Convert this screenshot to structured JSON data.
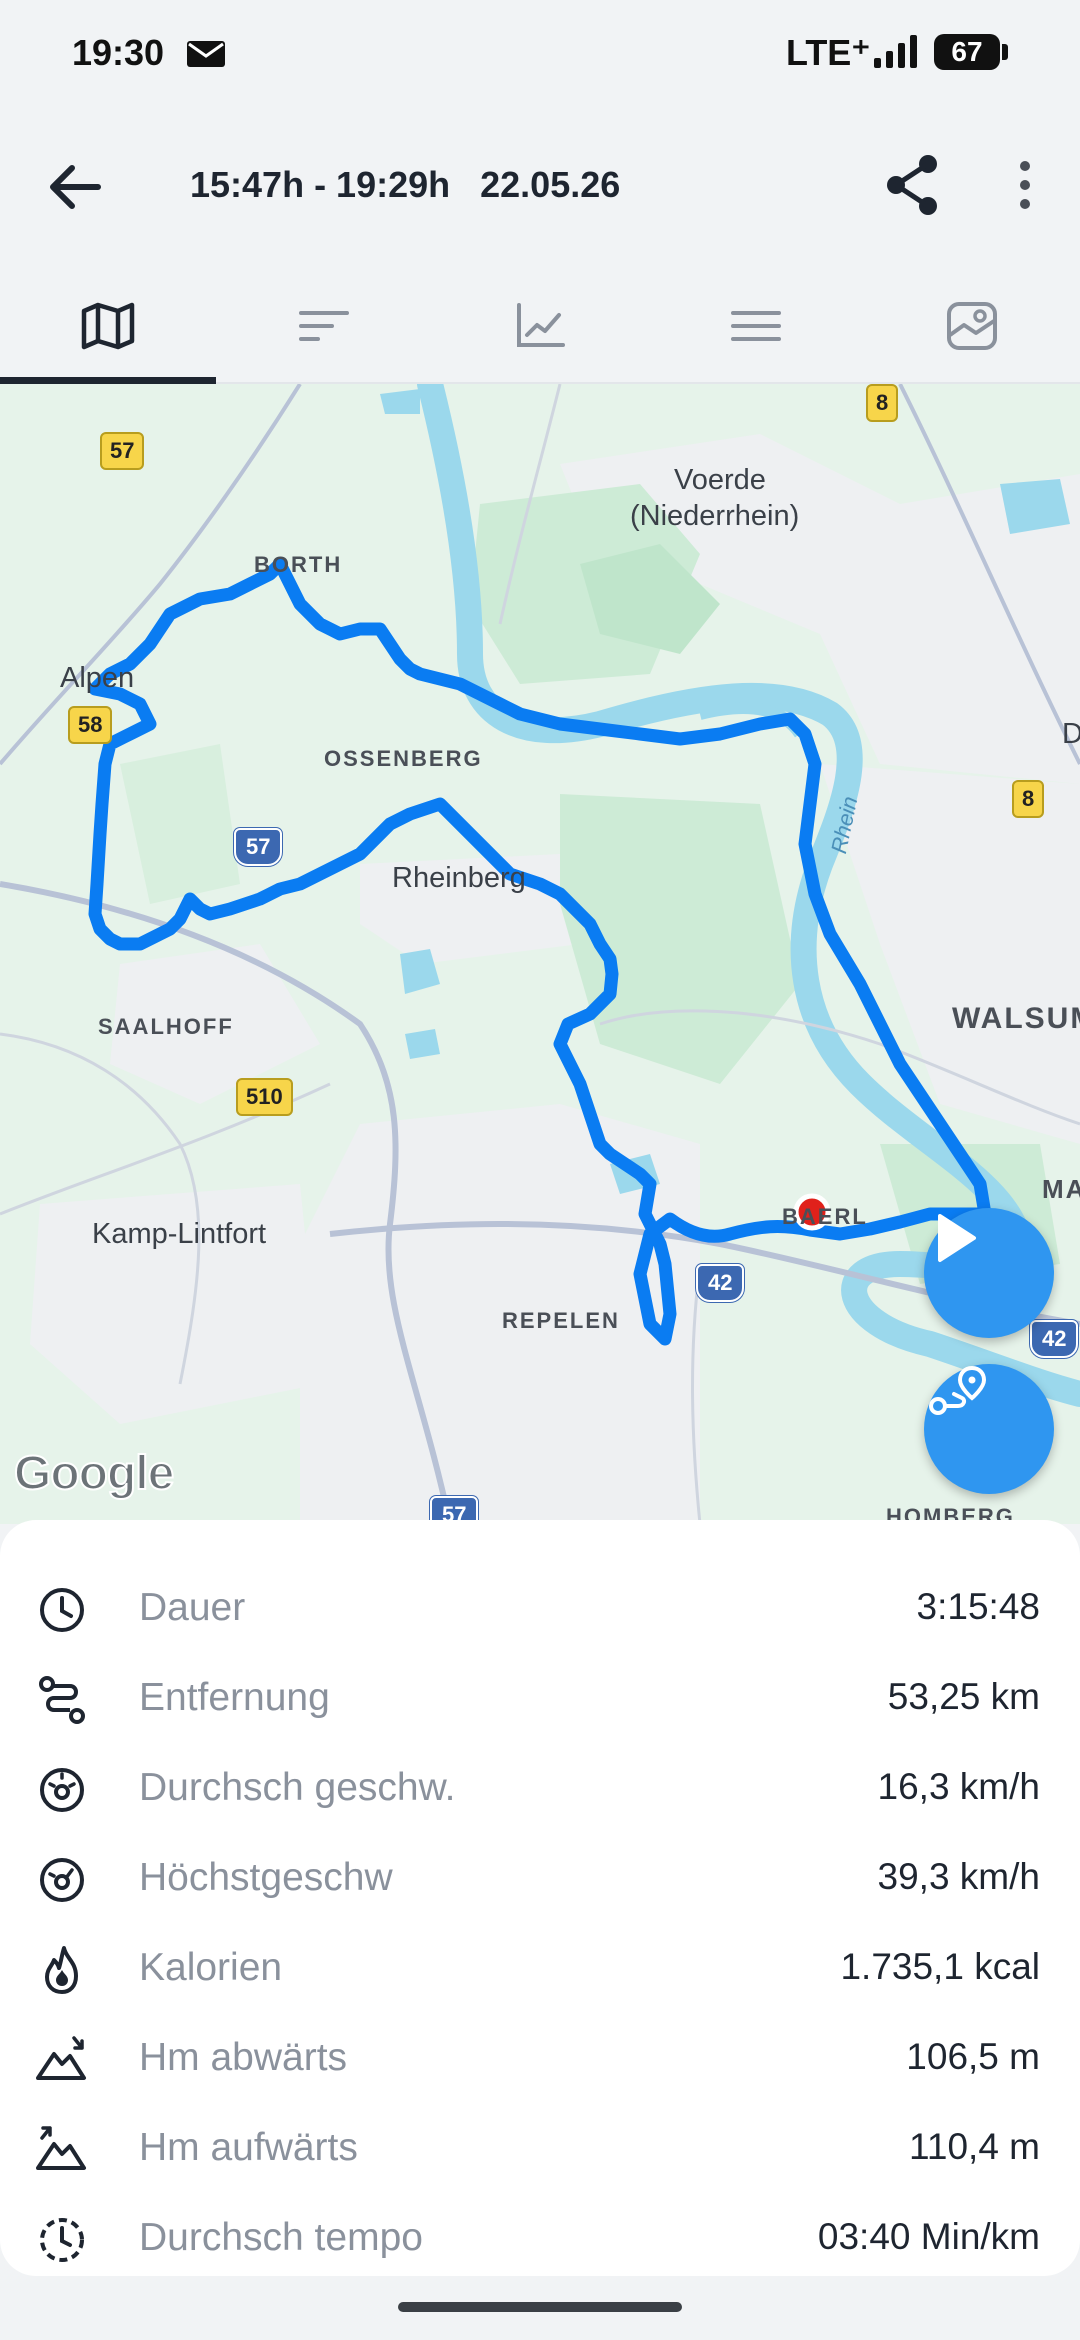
{
  "status_bar": {
    "time": "19:30",
    "network": "LTE⁺",
    "battery": "67"
  },
  "app_bar": {
    "title": "15:47h - 19:29h   22.05.26"
  },
  "tabs": [
    {
      "icon": "map-icon",
      "active": true
    },
    {
      "icon": "sort-icon",
      "active": false
    },
    {
      "icon": "chart-icon",
      "active": false
    },
    {
      "icon": "list-icon",
      "active": false
    },
    {
      "icon": "photo-icon",
      "active": false
    }
  ],
  "map": {
    "places": {
      "voerde": "Voerde",
      "voerde_sub": "(Niederrhein)",
      "borth": "BORTH",
      "alpen": "Alpen",
      "ossenberg": "OSSENBERG",
      "rheinberg": "Rheinberg",
      "saalhoff": "SAALHOFF",
      "walsum": "WALSUM",
      "kamp_lintfort": "Kamp-Lintfort",
      "repelen": "REPELEN",
      "baerl": "BAERL",
      "homberg": "HOMBERG",
      "ma": "MA",
      "d": "D",
      "rhein": "Rhein"
    },
    "shields": {
      "r57_top": "57",
      "r58": "58",
      "r8_top": "8",
      "r8_right": "8",
      "a57_mid": "57",
      "r510": "510",
      "a42_mid": "42",
      "a42_right": "42",
      "a57_bottom": "57"
    },
    "attribution": "Google",
    "colors": {
      "route": "#0a7cf2",
      "water": "#9bd8ec",
      "land": "#e6f3ea",
      "marker": "#e0211b"
    }
  },
  "stats": [
    {
      "icon": "clock-icon",
      "label": "Dauer",
      "value": "3:15:48"
    },
    {
      "icon": "route-icon",
      "label": "Entfernung",
      "value": "53,25 km"
    },
    {
      "icon": "speedometer-icon",
      "label": "Durchsch geschw.",
      "value": "16,3 km/h"
    },
    {
      "icon": "speedometer-max-icon",
      "label": "Höchstgeschw",
      "value": "39,3 km/h"
    },
    {
      "icon": "flame-icon",
      "label": "Kalorien",
      "value": "1.735,1 kcal"
    },
    {
      "icon": "mountain-down-icon",
      "label": "Hm abwärts",
      "value": "106,5 m"
    },
    {
      "icon": "mountain-up-icon",
      "label": "Hm aufwärts",
      "value": "110,4 m"
    },
    {
      "icon": "tempo-icon",
      "label": "Durchsch tempo",
      "value": "03:40 Min/km"
    }
  ]
}
